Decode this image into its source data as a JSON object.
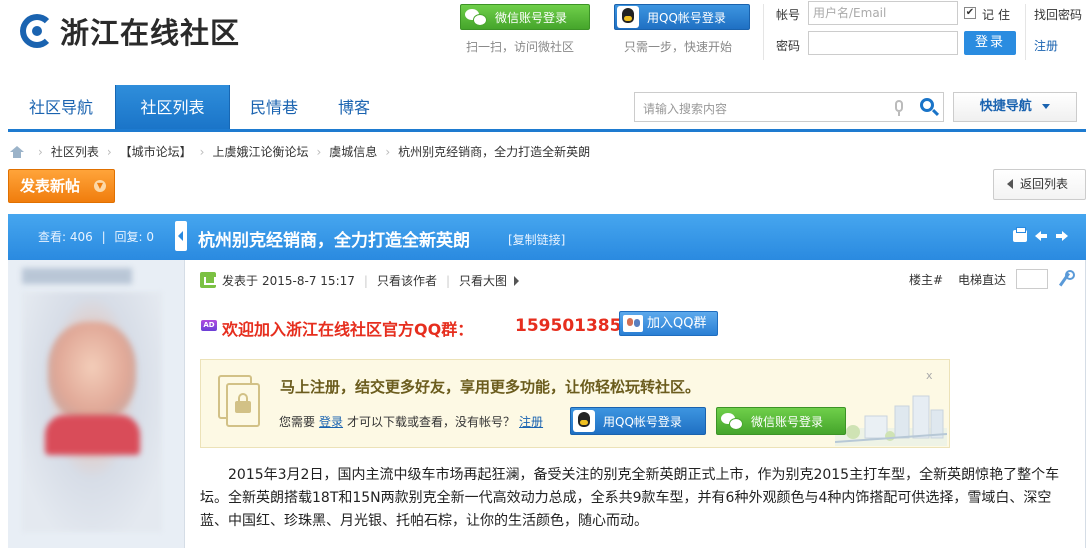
{
  "header": {
    "logo_text": "浙江在线社区",
    "wechat_login": "微信账号登录",
    "wechat_hint": "扫一扫，访问微社区",
    "qq_login": "用QQ帐号登录",
    "qq_hint": "只需一步，快速开始",
    "account_label": "帐号",
    "account_placeholder": "用户名/Email",
    "remember_label": "记住",
    "find_password": "找回密码",
    "password_label": "密码",
    "login_button": "登录",
    "register": "注册"
  },
  "nav": {
    "tabs": [
      {
        "label": "社区导航",
        "active": false
      },
      {
        "label": "社区列表",
        "active": true
      },
      {
        "label": "民情巷",
        "active": false
      },
      {
        "label": "博客",
        "active": false
      }
    ],
    "search_placeholder": "请输入搜索内容",
    "quick_nav": "快捷导航"
  },
  "breadcrumb": [
    "社区列表",
    "【城市论坛】",
    "上虞娥江论衡论坛",
    "虞城信息",
    "杭州别克经销商，全力打造全新英朗"
  ],
  "actions": {
    "new_post": "发表新帖",
    "back_to_list": "返回列表"
  },
  "thread": {
    "views_label": "查看:",
    "views": "406",
    "replies_label": "回复:",
    "replies": "0",
    "title": "杭州别克经销商，全力打造全新英朗",
    "copy_link": "[复制链接]"
  },
  "post": {
    "posted_prefix": "发表于",
    "posted_time": "2015-8-7 15:17",
    "author_only": "只看该作者",
    "big_image": "只看大图",
    "floor_label": "楼主#",
    "elevator_label": "电梯直达",
    "ad_badge": "AD",
    "ad_text": "欢迎加入浙江在线社区官方QQ群：",
    "ad_number": "159501385",
    "ad_button": "加入QQ群",
    "register_headline": "马上注册，结交更多好友，享用更多功能，让你轻松玩转社区。",
    "register_sub_1": "您需要",
    "register_sub_login": "登录",
    "register_sub_2": "才可以下载或查看，没有帐号？",
    "register_sub_register": "注册",
    "register_qq": "用QQ帐号登录",
    "register_wechat": "微信账号登录",
    "register_close": "x",
    "body": "2015年3月2日，国内主流中级车市场再起狂澜，备受关注的别克全新英朗正式上市，作为别克2015主打车型，全新英朗惊艳了整个车坛。全新英朗搭载18T和15N两款别克全新一代高效动力总成，全系共9款车型，并有6种外观颜色与4种内饰搭配可供选择，雪域白、深空蓝、中国红、珍珠黑、月光银、托帕石棕，让你的生活颜色，随心而动。"
  },
  "colors": {
    "brand_blue": "#1a74c8",
    "accent_orange": "#f07d0d",
    "wechat_green": "#45a52b",
    "ad_red": "#e62e1e"
  }
}
